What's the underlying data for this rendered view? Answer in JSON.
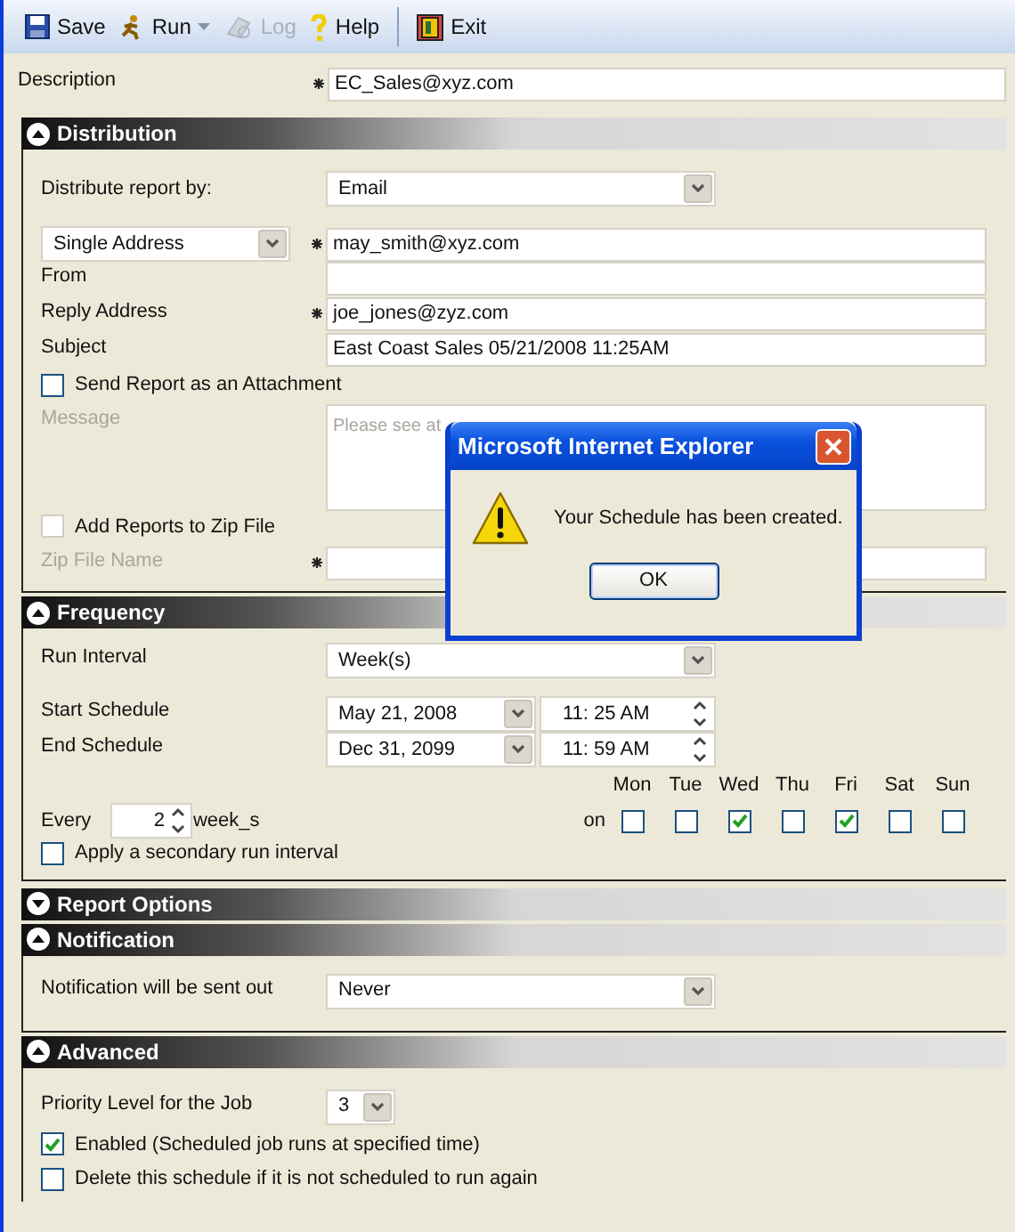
{
  "toolbar": [
    {
      "kind": "save",
      "label": "Save",
      "disabled": false,
      "caret": false
    },
    {
      "kind": "run",
      "label": "Run",
      "disabled": false,
      "caret": true
    },
    {
      "kind": "log",
      "label": "Log",
      "disabled": true,
      "caret": false
    },
    {
      "kind": "help",
      "label": "Help",
      "disabled": false,
      "caret": false
    },
    {
      "kind": "exit",
      "label": "Exit",
      "disabled": false,
      "caret": false
    }
  ],
  "description": {
    "label": "Description",
    "value": "EC_Sales@xyz.com",
    "required": true
  },
  "distribution": {
    "title": "Distribution",
    "expanded": true,
    "distribute_by": {
      "label": "Distribute report by:",
      "value": "Email"
    },
    "address_type": {
      "value": "Single Address"
    },
    "fields": [
      {
        "value": "may_smith@xyz.com",
        "required": true
      },
      {
        "label": "From",
        "required": false
      },
      {
        "label": "Reply Address",
        "value": "joe_jones@zyz.com",
        "required": true
      },
      {
        "label": "Subject",
        "value": "East Coast Sales 05/21/2008 11:25AM",
        "required": false
      }
    ],
    "attachment": {
      "label": "Send Report as an Attachment",
      "checked": false,
      "disabled": false
    },
    "message": {
      "label": "Message",
      "value": "Please see at",
      "disabled": true
    },
    "zip": {
      "label": "Add Reports to Zip File",
      "checked": false,
      "disabled": true
    },
    "zip_name": {
      "label": "Zip File Name",
      "required": true,
      "disabled": true
    }
  },
  "frequency": {
    "title": "Frequency",
    "expanded": true,
    "run_interval": {
      "label": "Run Interval",
      "value": "Week(s)"
    },
    "schedule": [
      {
        "label": "Start Schedule",
        "date": "May 21, 2008",
        "hour": "11:",
        "minute": "25",
        "ampm": "AM"
      },
      {
        "label": "End Schedule",
        "date": "Dec 31, 2099",
        "hour": "11:",
        "minute": "59",
        "ampm": "AM"
      }
    ],
    "every": {
      "label": "Every",
      "value": "2",
      "unit": "week_s"
    },
    "on_label": "on",
    "days": [
      {
        "label": "Mon",
        "checked": false
      },
      {
        "label": "Tue",
        "checked": false
      },
      {
        "label": "Wed",
        "checked": true
      },
      {
        "label": "Thu",
        "checked": false
      },
      {
        "label": "Fri",
        "checked": true
      },
      {
        "label": "Sat",
        "checked": false
      },
      {
        "label": "Sun",
        "checked": false
      }
    ],
    "secondary": {
      "label": "Apply a secondary run interval",
      "checked": false
    }
  },
  "report_options": {
    "title": "Report Options",
    "expanded": false
  },
  "notification": {
    "title": "Notification",
    "expanded": true,
    "field": {
      "label": "Notification will be sent out",
      "value": "Never"
    }
  },
  "advanced": {
    "title": "Advanced",
    "expanded": true,
    "priority": {
      "label": "Priority Level for the Job",
      "value": "3"
    },
    "options": [
      {
        "label": "Enabled (Scheduled job runs at specified time)",
        "checked": true
      },
      {
        "label": "Delete this schedule if it is not scheduled to run again",
        "checked": false
      }
    ]
  },
  "dialog": {
    "title": "Microsoft Internet Explorer",
    "message": "Your Schedule has been created.",
    "button": "OK"
  }
}
